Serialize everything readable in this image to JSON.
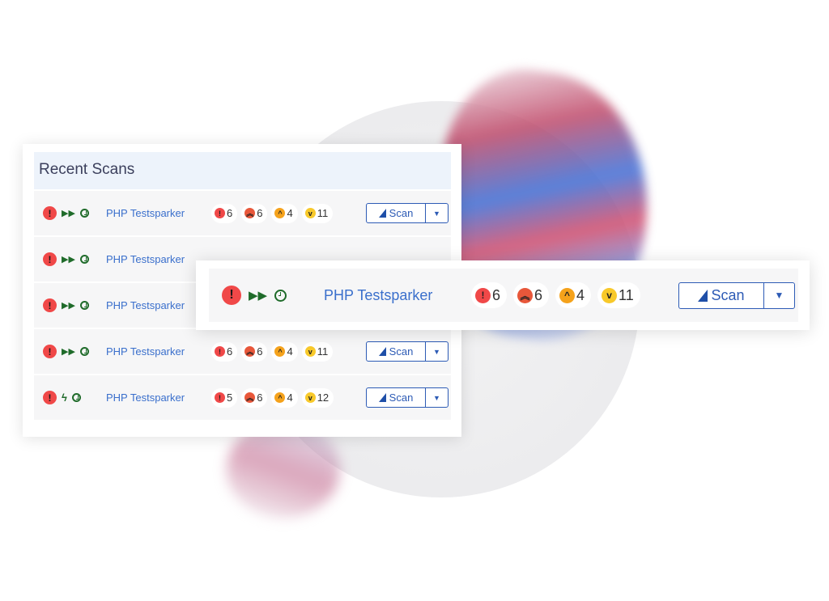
{
  "title": "Recent Scans",
  "colors": {
    "critical": "#f04848",
    "high": "#e8573a",
    "medium": "#f5a21b",
    "low": "#f8c92a",
    "link": "#3a6fcc",
    "button": "#2d5bb5",
    "status": "#1f6b2a"
  },
  "rows": [
    {
      "status_icons": [
        "critical-icon",
        "fast-forward-icon",
        "clock-icon"
      ],
      "name": "PHP Testsparker",
      "counts": {
        "critical": "6",
        "high": "6",
        "medium": "4",
        "low": "11"
      },
      "button": "Scan"
    },
    {
      "status_icons": [
        "critical-icon",
        "fast-forward-icon",
        "clock-icon"
      ],
      "name": "PHP Testsparker"
    },
    {
      "status_icons": [
        "critical-icon",
        "fast-forward-icon",
        "clock-icon"
      ],
      "name": "PHP Testsparker"
    },
    {
      "status_icons": [
        "critical-icon",
        "fast-forward-icon",
        "clock-icon"
      ],
      "name": "PHP Testsparker",
      "counts": {
        "critical": "6",
        "high": "6",
        "medium": "4",
        "low": "11"
      },
      "button": "Scan"
    },
    {
      "status_icons": [
        "critical-icon",
        "lightning-icon",
        "clock-icon"
      ],
      "name": "PHP Testsparker",
      "counts": {
        "critical": "5",
        "high": "6",
        "medium": "4",
        "low": "12"
      },
      "button": "Scan"
    }
  ],
  "highlight": {
    "name": "PHP Testsparker",
    "counts": {
      "critical": "6",
      "high": "6",
      "medium": "4",
      "low": "11"
    },
    "button": "Scan"
  }
}
